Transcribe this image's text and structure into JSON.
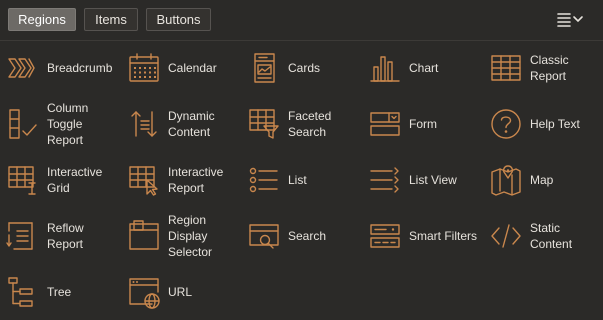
{
  "tabs": {
    "regions": "Regions",
    "items": "Items",
    "buttons": "Buttons"
  },
  "menu_icon": "hamburger-menu-chevron-icon",
  "colors": {
    "background": "#2b2a28",
    "accent": "#c9874d",
    "active_tab": "#6d6a66",
    "text": "#e6e2dc"
  },
  "regions": [
    {
      "label": "Breadcrumb",
      "icon": "breadcrumb-icon"
    },
    {
      "label": "Calendar",
      "icon": "calendar-icon"
    },
    {
      "label": "Cards",
      "icon": "cards-icon"
    },
    {
      "label": "Chart",
      "icon": "chart-icon"
    },
    {
      "label": "Classic\nReport",
      "icon": "classic-report-icon"
    },
    {
      "label": "Column\nToggle\nReport",
      "icon": "column-toggle-report-icon"
    },
    {
      "label": "Dynamic\nContent",
      "icon": "dynamic-content-icon"
    },
    {
      "label": "Faceted\nSearch",
      "icon": "faceted-search-icon"
    },
    {
      "label": "Form",
      "icon": "form-icon"
    },
    {
      "label": "Help Text",
      "icon": "help-text-icon"
    },
    {
      "label": "Interactive\nGrid",
      "icon": "interactive-grid-icon"
    },
    {
      "label": "Interactive\nReport",
      "icon": "interactive-report-icon"
    },
    {
      "label": "List",
      "icon": "list-icon"
    },
    {
      "label": "List View",
      "icon": "list-view-icon"
    },
    {
      "label": "Map",
      "icon": "map-icon"
    },
    {
      "label": "Reflow\nReport",
      "icon": "reflow-report-icon"
    },
    {
      "label": "Region\nDisplay\nSelector",
      "icon": "region-display-selector-icon"
    },
    {
      "label": "Search",
      "icon": "search-icon"
    },
    {
      "label": "Smart Filters",
      "icon": "smart-filters-icon"
    },
    {
      "label": "Static\nContent",
      "icon": "static-content-icon"
    },
    {
      "label": "Tree",
      "icon": "tree-icon"
    },
    {
      "label": "URL",
      "icon": "url-icon"
    }
  ]
}
